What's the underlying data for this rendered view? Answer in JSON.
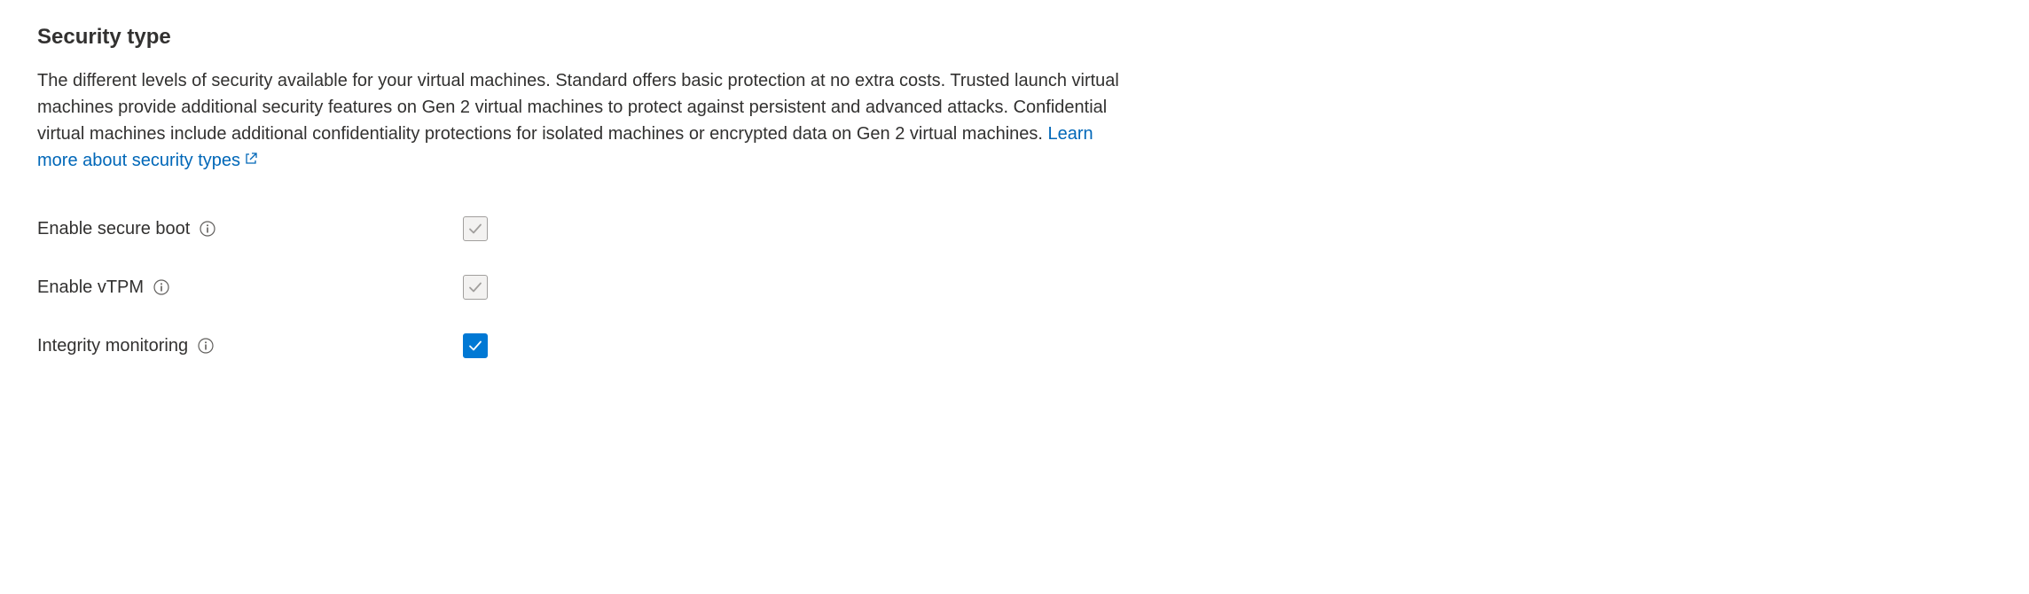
{
  "section": {
    "heading": "Security type",
    "description": "The different levels of security available for your virtual machines. Standard offers basic protection at no extra costs. Trusted launch virtual machines provide additional security features on Gen 2 virtual machines to protect against persistent and advanced attacks. Confidential virtual machines include additional confidentiality protections for isolated machines or encrypted data on Gen 2 virtual machines. ",
    "link_text": "Learn more about security types"
  },
  "fields": {
    "secure_boot": {
      "label": "Enable secure boot",
      "checked": true,
      "disabled": true
    },
    "vtpm": {
      "label": "Enable vTPM",
      "checked": true,
      "disabled": true
    },
    "integrity_monitoring": {
      "label": "Integrity monitoring",
      "checked": true,
      "disabled": false
    }
  }
}
